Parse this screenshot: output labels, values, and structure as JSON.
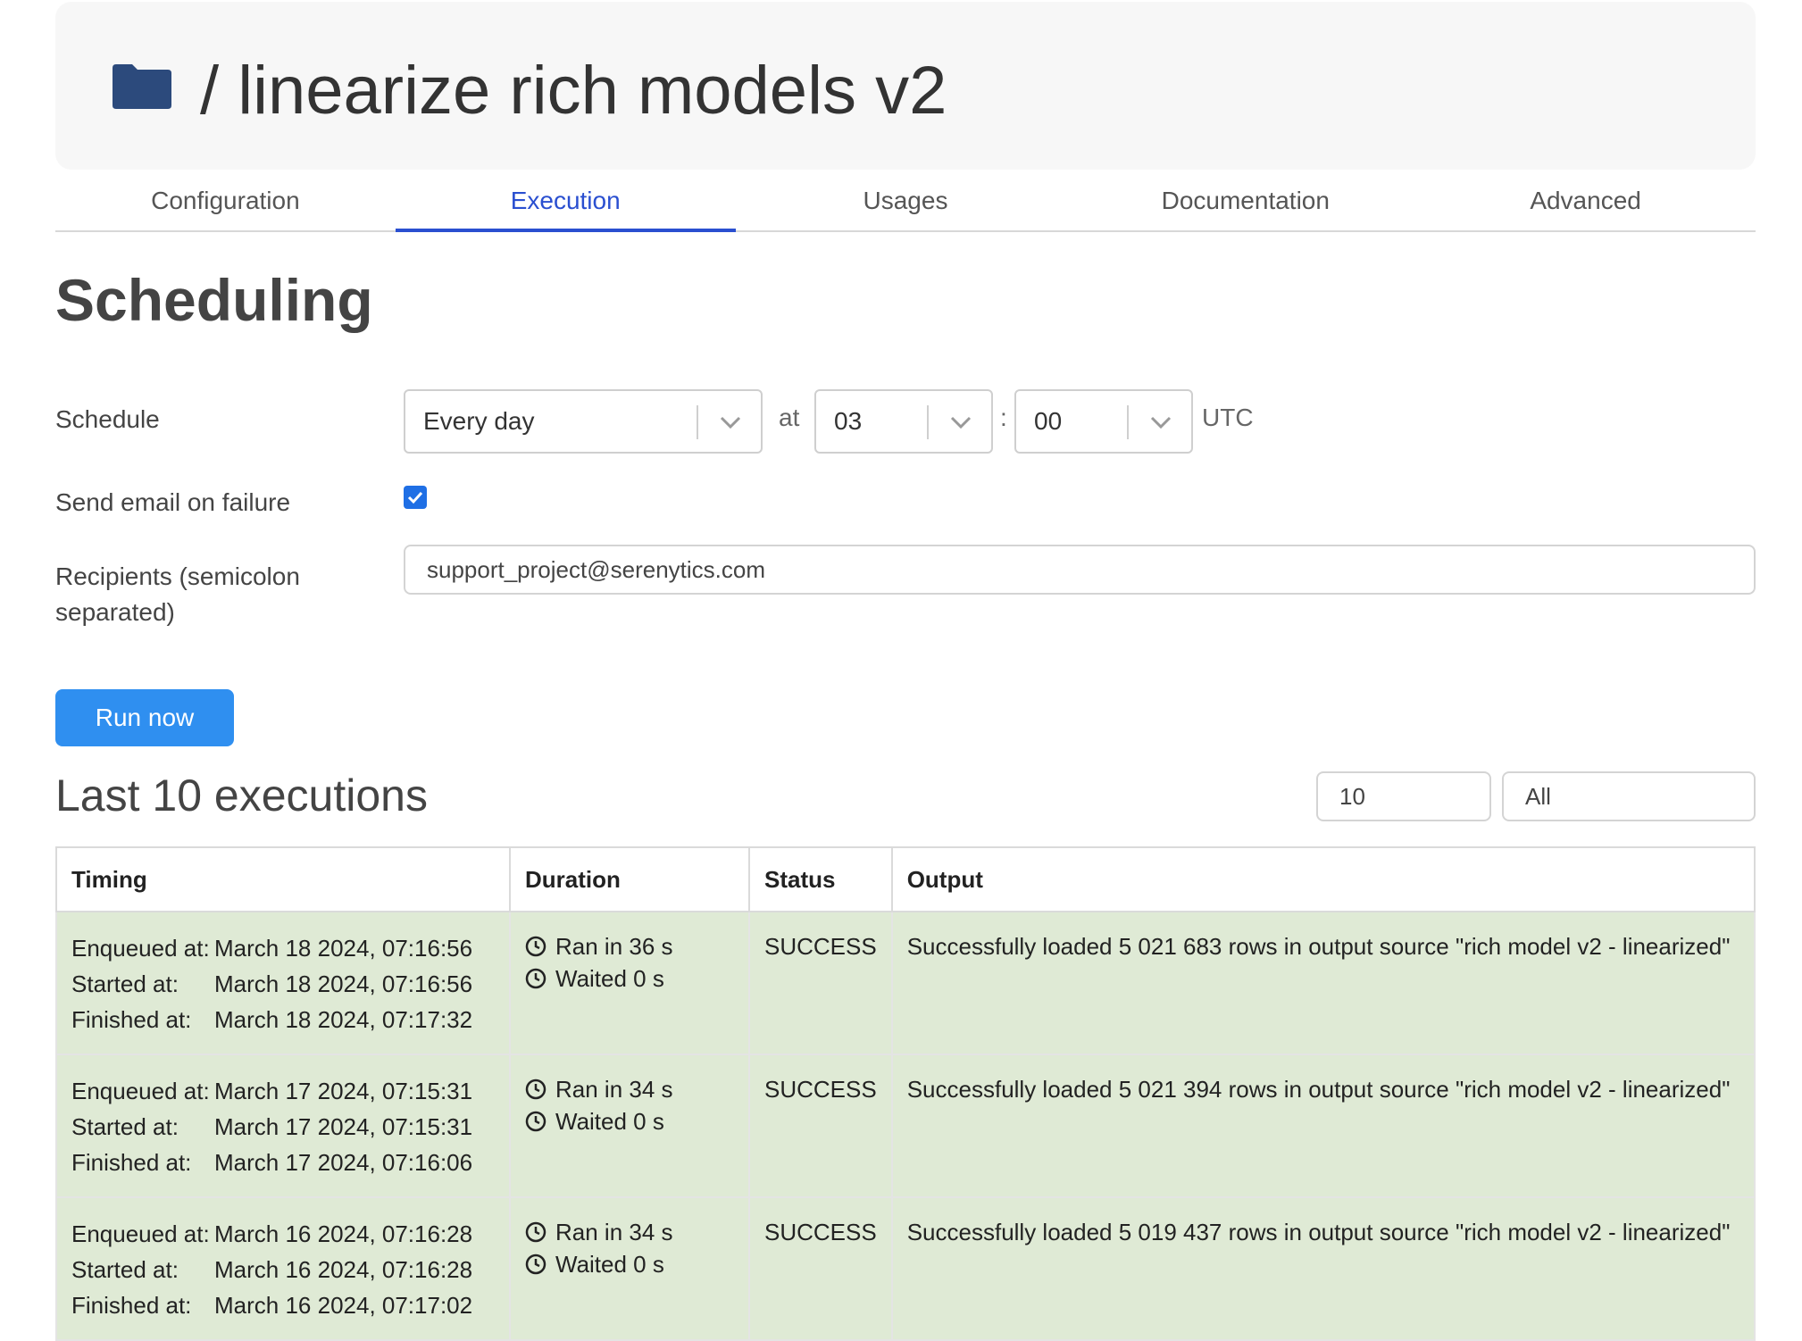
{
  "header": {
    "title": "/  linearize rich models v2"
  },
  "tabs": [
    {
      "label": "Configuration"
    },
    {
      "label": "Execution"
    },
    {
      "label": "Usages"
    },
    {
      "label": "Documentation"
    },
    {
      "label": "Advanced"
    }
  ],
  "scheduling": {
    "title": "Scheduling",
    "schedule_label": "Schedule",
    "frequency": "Every day",
    "at_label": "at",
    "hour": "03",
    "colon": ":",
    "minute": "00",
    "timezone": "UTC",
    "email_label": "Send email on failure",
    "email_checked": true,
    "recipients_label": "Recipients (semicolon separated)",
    "recipients_value": "support_project@serenytics.com"
  },
  "run_now": "Run now",
  "executions": {
    "title": "Last 10 executions",
    "limit": "10",
    "filter": "All",
    "columns": [
      "Timing",
      "Duration",
      "Status",
      "Output"
    ],
    "timing_labels": [
      "Enqueued at:",
      "Started at:",
      "Finished at:"
    ],
    "rows": [
      {
        "enqueued": "March 18 2024, 07:16:56",
        "started": "March 18 2024, 07:16:56",
        "finished": "March 18 2024, 07:17:32",
        "ran": "Ran in 36 s",
        "waited": "Waited 0 s",
        "status": "SUCCESS",
        "output": "Successfully loaded 5 021 683 rows in output source \"rich model v2 - linearized\""
      },
      {
        "enqueued": "March 17 2024, 07:15:31",
        "started": "March 17 2024, 07:15:31",
        "finished": "March 17 2024, 07:16:06",
        "ran": "Ran in 34 s",
        "waited": "Waited 0 s",
        "status": "SUCCESS",
        "output": "Successfully loaded 5 021 394 rows in output source \"rich model v2 - linearized\""
      },
      {
        "enqueued": "March 16 2024, 07:16:28",
        "started": "March 16 2024, 07:16:28",
        "finished": "March 16 2024, 07:17:02",
        "ran": "Ran in 34 s",
        "waited": "Waited 0 s",
        "status": "SUCCESS",
        "output": "Successfully loaded 5 019 437 rows in output source \"rich model v2 - linearized\""
      }
    ]
  },
  "colors": {
    "accent": "#2a4fd0",
    "button": "#2f8ff0",
    "success_row": "#dfead5",
    "folder": "#2c4a7c"
  }
}
